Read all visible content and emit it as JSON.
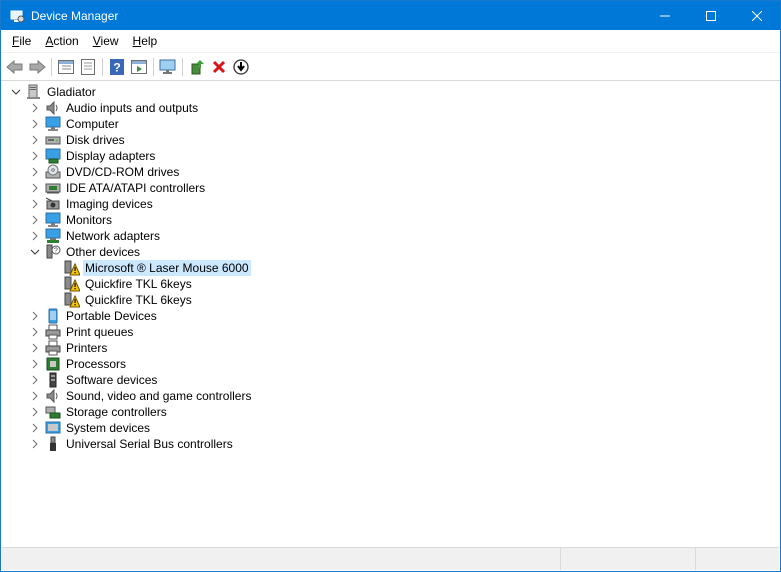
{
  "window": {
    "title": "Device Manager"
  },
  "menu": [
    {
      "label": "File",
      "name": "menu-file"
    },
    {
      "label": "Action",
      "name": "menu-action"
    },
    {
      "label": "View",
      "name": "menu-view"
    },
    {
      "label": "Help",
      "name": "menu-help"
    }
  ],
  "toolbar": [
    "back-icon",
    "forward-icon",
    "properties-pane-icon",
    "document-icon",
    "help-icon",
    "action-pane-icon",
    "monitor-icon",
    "update-driver-icon",
    "uninstall-icon",
    "disable-device-icon"
  ],
  "tree": {
    "root": "Gladiator",
    "categories": [
      {
        "label": "Audio inputs and outputs",
        "icon": "speaker-icon"
      },
      {
        "label": "Computer",
        "icon": "computer-icon"
      },
      {
        "label": "Disk drives",
        "icon": "disk-drive-icon"
      },
      {
        "label": "Display adapters",
        "icon": "display-adapter-icon"
      },
      {
        "label": "DVD/CD-ROM drives",
        "icon": "dvd-drive-icon"
      },
      {
        "label": "IDE ATA/ATAPI controllers",
        "icon": "ide-controller-icon"
      },
      {
        "label": "Imaging devices",
        "icon": "camera-icon"
      },
      {
        "label": "Monitors",
        "icon": "monitor-icon"
      },
      {
        "label": "Network adapters",
        "icon": "network-adapter-icon"
      },
      {
        "label": "Other devices",
        "icon": "unknown-device-icon",
        "expanded": true,
        "children": [
          {
            "label": "Microsoft ® Laser Mouse 6000",
            "selected": true
          },
          {
            "label": "Quickfire TKL 6keys"
          },
          {
            "label": "Quickfire TKL 6keys"
          }
        ]
      },
      {
        "label": "Portable Devices",
        "icon": "portable-device-icon"
      },
      {
        "label": "Print queues",
        "icon": "printer-icon"
      },
      {
        "label": "Printers",
        "icon": "printer-icon"
      },
      {
        "label": "Processors",
        "icon": "processor-icon"
      },
      {
        "label": "Software devices",
        "icon": "software-device-icon"
      },
      {
        "label": "Sound, video and game controllers",
        "icon": "speaker-icon"
      },
      {
        "label": "Storage controllers",
        "icon": "storage-controller-icon"
      },
      {
        "label": "System devices",
        "icon": "system-device-icon"
      },
      {
        "label": "Universal Serial Bus controllers",
        "icon": "usb-icon"
      }
    ]
  }
}
